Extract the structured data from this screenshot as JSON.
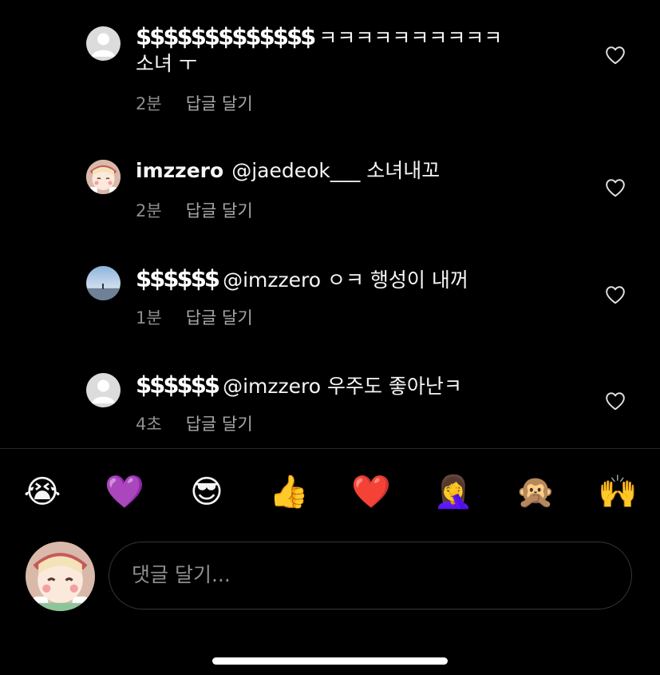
{
  "comments": [
    {
      "username": "$$$$$$$$$$$$$",
      "line1": "ㅋㅋㅋㅋㅋㅋㅋㅋㅋㅋ",
      "line2": "소녀 ㅜ",
      "time": "2분",
      "reply_label": "답글 달기",
      "avatar": "default-avatar"
    },
    {
      "username": "imzzero",
      "text": "@jaedeok___ 소녀내꼬",
      "time": "2분",
      "reply_label": "답글 달기",
      "avatar": "cartoon-avatar"
    },
    {
      "username": "$$$$$$",
      "text": "@imzzero ㅇㅋ 행성이 내꺼",
      "time": "1분",
      "reply_label": "답글 달기",
      "avatar": "landscape-avatar"
    },
    {
      "username": "$$$$$$",
      "text": "@imzzero 우주도 좋아난ㅋ",
      "time": "4초",
      "reply_label": "답글 달기",
      "avatar": "default-avatar"
    }
  ],
  "quick_reactions": [
    "😭",
    "💜",
    "😎",
    "👍",
    "❤️",
    "🤦‍♀️",
    "🙊",
    "🙌"
  ],
  "composer": {
    "placeholder": "댓글 달기..."
  },
  "colors": {
    "background": "#000000",
    "text": "#f5f5f5",
    "secondary": "#8e8e8e"
  }
}
